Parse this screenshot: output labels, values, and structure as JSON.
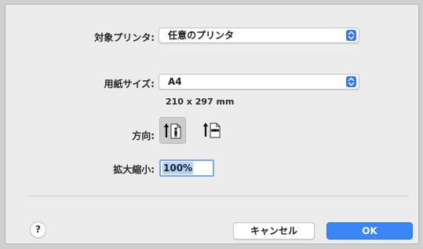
{
  "printer": {
    "label": "対象プリンタ:",
    "value": "任意のプリンタ"
  },
  "paper": {
    "label": "用紙サイズ:",
    "value": "A4",
    "dimensions": "210 x 297 mm"
  },
  "orientation": {
    "label": "方向:",
    "options": [
      {
        "name": "portrait",
        "selected": true
      },
      {
        "name": "landscape",
        "selected": false
      }
    ]
  },
  "scale": {
    "label": "拡大縮小:",
    "value": "100%"
  },
  "buttons": {
    "help": "?",
    "cancel": "キャンセル",
    "ok": "OK"
  },
  "colors": {
    "accent": "#3b86f7",
    "dialog_bg": "#ececec",
    "selection": "#b3d3fb"
  },
  "icons": {
    "popup_stepper": "up-down-chevron-icon",
    "portrait": "portrait-orientation-icon",
    "landscape": "landscape-orientation-icon"
  }
}
